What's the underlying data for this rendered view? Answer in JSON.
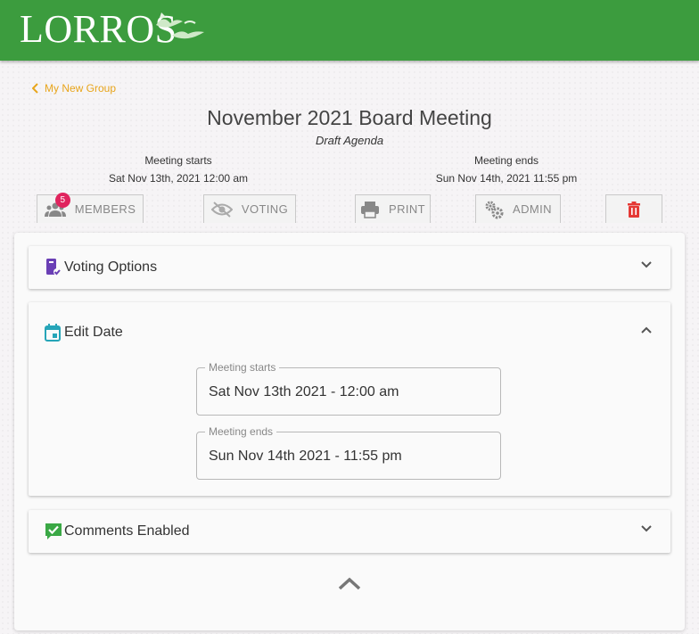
{
  "brand": {
    "logo_text": "LORROS",
    "color": "#3c9c3e"
  },
  "nav": {
    "back_label": "My New Group"
  },
  "meeting": {
    "title": "November 2021 Board Meeting",
    "status": "Draft Agenda",
    "starts_label": "Meeting starts",
    "starts_value": "Sat Nov 13th, 2021 12:00 am",
    "ends_label": "Meeting ends",
    "ends_value": "Sun Nov 14th, 2021 11:55 pm"
  },
  "toolbar": {
    "members_label": "MEMBERS",
    "members_count": "5",
    "voting_label": "VOTING",
    "print_label": "PRINT",
    "admin_label": "ADMIN",
    "delete_icon": "trash-icon"
  },
  "panels": {
    "voting_options": {
      "label": "Voting Options",
      "icon": "ballot-icon",
      "expanded": false
    },
    "edit_date": {
      "label": "Edit Date",
      "icon": "calendar-icon",
      "expanded": true,
      "start_legend": "Meeting starts",
      "start_value": "Sat Nov 13th 2021 - 12:00 am",
      "end_legend": "Meeting ends",
      "end_value": "Sun Nov 14th 2021 - 11:55 pm"
    },
    "comments": {
      "label": "Comments Enabled",
      "icon": "comment-check-icon",
      "expanded": false
    }
  },
  "colors": {
    "accent": "#e8a51b",
    "badge": "#e0245e",
    "delete": "#e53935",
    "voting_icon": "#6a3fb5",
    "calendar_icon": "#26a5b8",
    "comments_icon": "#3aa845"
  }
}
